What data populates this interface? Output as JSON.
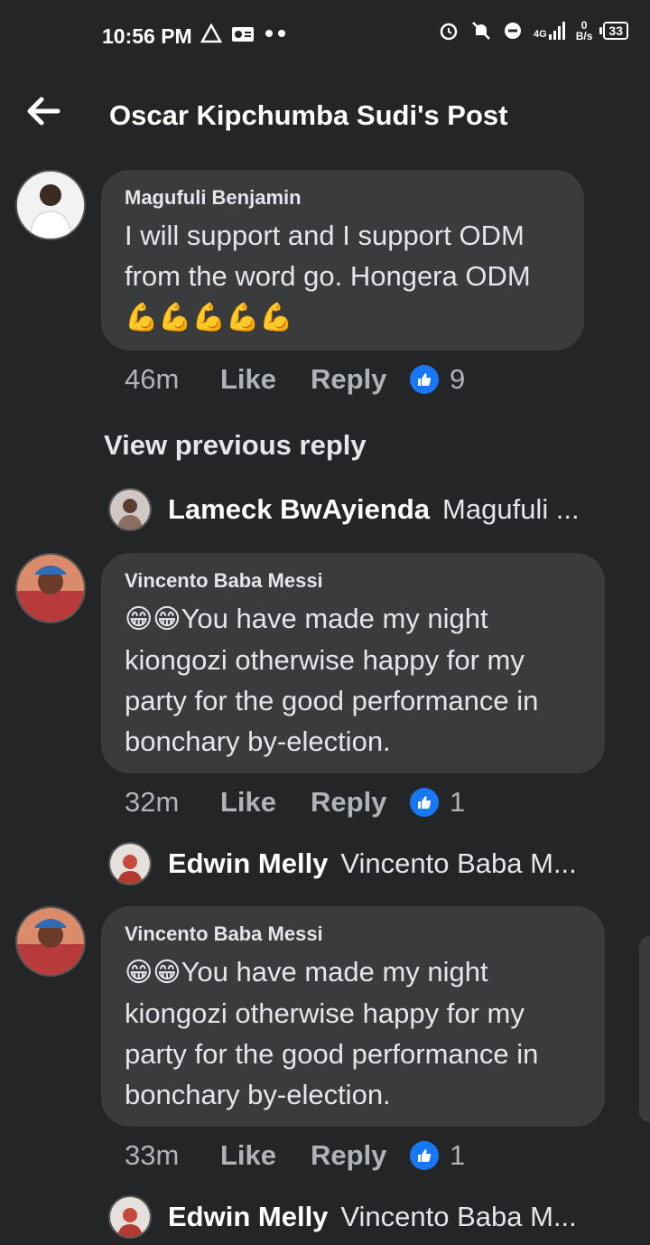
{
  "status_bar": {
    "time": "10:56 PM",
    "network": "4G",
    "speed_value": "0",
    "speed_unit": "B/s",
    "battery": "33"
  },
  "header": {
    "title": "Oscar Kipchumba Sudi's Post"
  },
  "comments": [
    {
      "author": "Magufuli Benjamin",
      "text": "I will support and I support ODM from the word go. Hongera ODM",
      "emoji_suffix": "💪💪💪💪💪",
      "time": "46m",
      "like_label": "Like",
      "reply_label": "Reply",
      "reactions": "9"
    },
    {
      "author": "Vincento Baba Messi",
      "emoji_prefix": "😁😁",
      "text": "You have made my night kiongozi otherwise happy  for my party for the good performance in bonchary by-election.",
      "time": "32m",
      "like_label": "Like",
      "reply_label": "Reply",
      "reactions": "1"
    },
    {
      "author": "Vincento Baba Messi",
      "emoji_prefix": "😁😁",
      "text": "You have made my night kiongozi otherwise happy  for my party for the good performance in bonchary by-election.",
      "time": "33m",
      "like_label": "Like",
      "reply_label": "Reply",
      "reactions": "1"
    }
  ],
  "view_previous_reply": "View previous reply",
  "replies": [
    {
      "name": "Lameck BwAyienda",
      "preview": "Magufuli ..."
    },
    {
      "name": "Edwin Melly",
      "preview": "Vincento Baba M..."
    },
    {
      "name": "Edwin Melly",
      "preview": "Vincento Baba M..."
    }
  ],
  "colors": {
    "background": "#242527",
    "bubble": "#3a3b3c",
    "like_blue": "#1877f2",
    "muted_text": "#b0b3b8"
  }
}
